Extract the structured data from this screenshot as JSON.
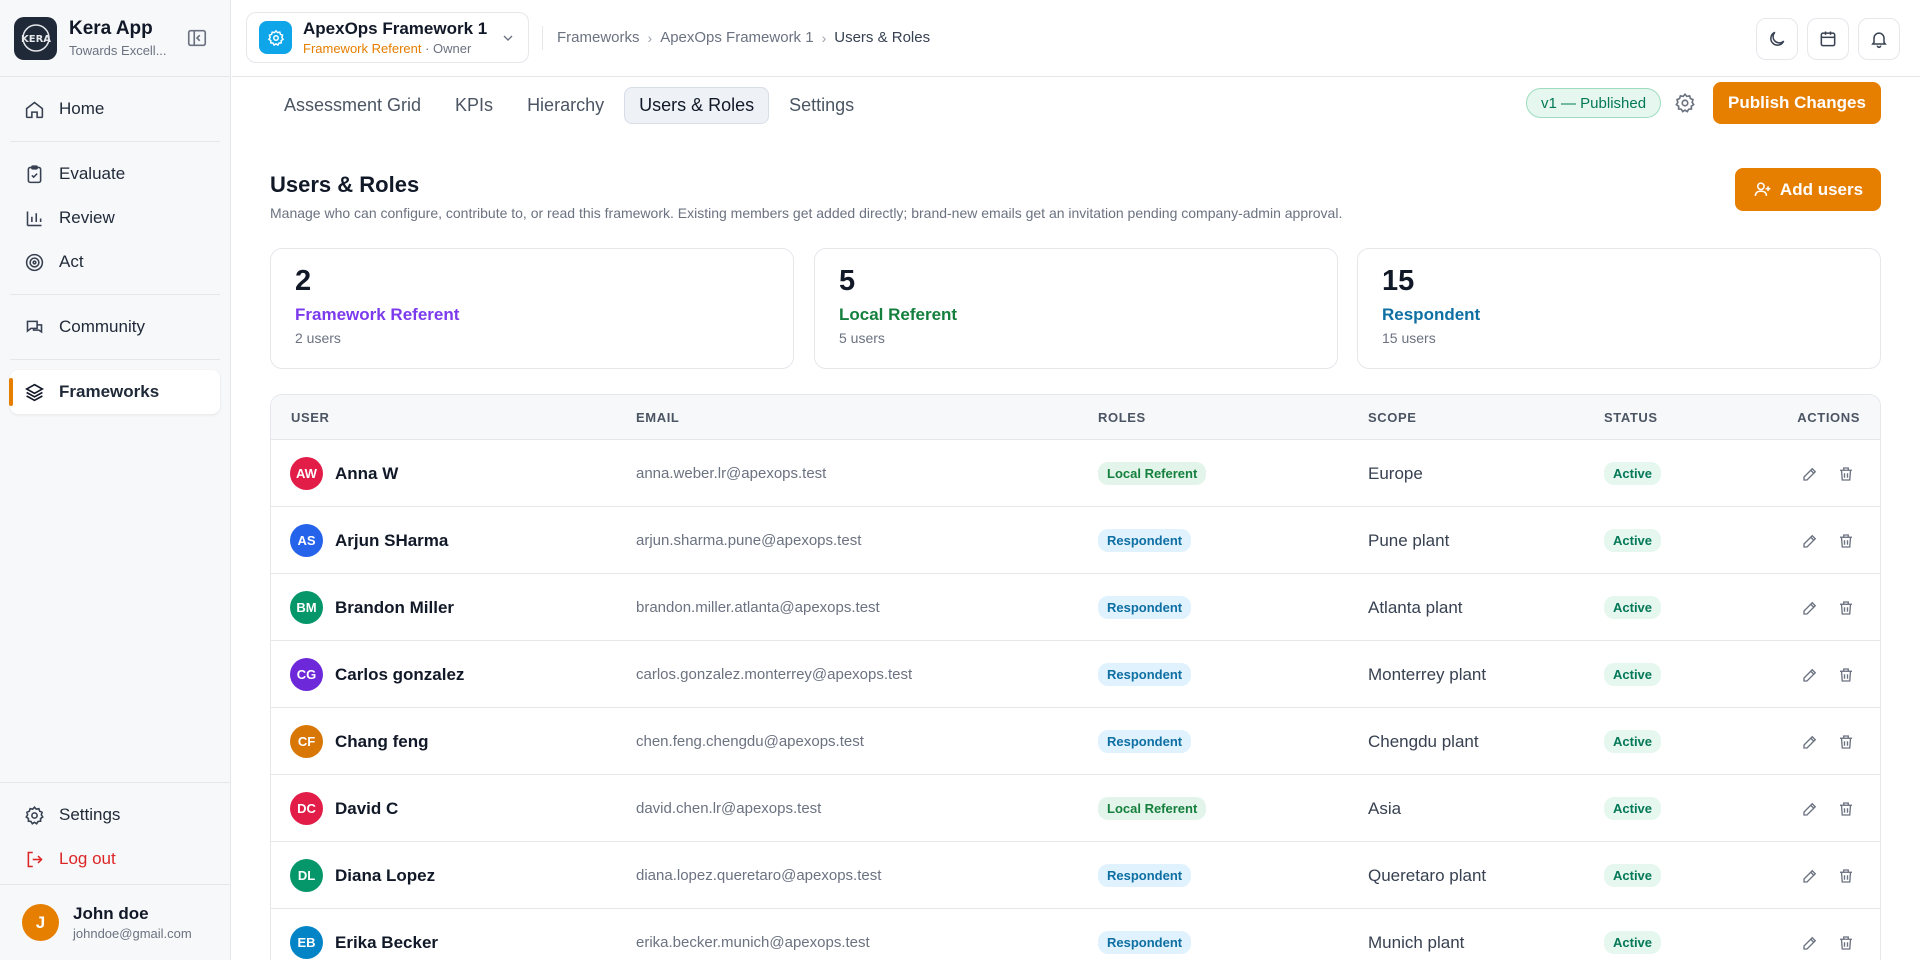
{
  "app": {
    "name": "Kera App",
    "tagline": "Towards Excell..."
  },
  "sidebar": {
    "items": [
      {
        "label": "Home",
        "icon": "home-icon"
      },
      {
        "label": "Evaluate",
        "icon": "clipboard-check-icon"
      },
      {
        "label": "Review",
        "icon": "bar-chart-icon"
      },
      {
        "label": "Act",
        "icon": "target-icon"
      },
      {
        "label": "Community",
        "icon": "chat-icon"
      },
      {
        "label": "Frameworks",
        "icon": "layers-icon"
      }
    ],
    "bottom": [
      {
        "label": "Settings",
        "icon": "gear-icon"
      },
      {
        "label": "Log out",
        "icon": "logout-icon"
      }
    ],
    "user": {
      "initial": "J",
      "name": "John doe",
      "email": "johndoe@gmail.com"
    }
  },
  "header": {
    "framework": {
      "name": "ApexOps Framework 1",
      "role": "Framework Referent",
      "separator": " · ",
      "owner": "Owner"
    },
    "breadcrumb": [
      "Frameworks",
      "ApexOps Framework 1",
      "Users & Roles"
    ]
  },
  "tabs": [
    "Assessment Grid",
    "KPIs",
    "Hierarchy",
    "Users & Roles",
    "Settings"
  ],
  "version_status": "v1 — Published",
  "publish_label": "Publish Changes",
  "page": {
    "title": "Users & Roles",
    "description": "Manage who can configure, contribute to, or read this framework. Existing members get added directly; brand-new emails get an invitation pending company-admin approval.",
    "add_label": "Add users"
  },
  "stats": [
    {
      "value": "2",
      "label": "Framework Referent",
      "sub": "2 users",
      "color": "#7c3aed"
    },
    {
      "value": "5",
      "label": "Local Referent",
      "sub": "5 users",
      "color": "#15803d"
    },
    {
      "value": "15",
      "label": "Respondent",
      "sub": "15 users",
      "color": "#0e6fa3"
    }
  ],
  "table": {
    "columns": [
      "USER",
      "EMAIL",
      "ROLES",
      "SCOPE",
      "STATUS",
      "ACTIONS"
    ],
    "rows": [
      {
        "initials": "AW",
        "color": "#e11d48",
        "name": "Anna W",
        "email": "anna.weber.lr@apexops.test",
        "role": "Local Referent",
        "role_type": "local",
        "scope": "Europe",
        "status": "Active"
      },
      {
        "initials": "AS",
        "color": "#2563eb",
        "name": "Arjun SHarma",
        "email": "arjun.sharma.pune@apexops.test",
        "role": "Respondent",
        "role_type": "resp",
        "scope": "Pune plant",
        "status": "Active"
      },
      {
        "initials": "BM",
        "color": "#059669",
        "name": "Brandon Miller",
        "email": "brandon.miller.atlanta@apexops.test",
        "role": "Respondent",
        "role_type": "resp",
        "scope": "Atlanta plant",
        "status": "Active"
      },
      {
        "initials": "CG",
        "color": "#6d28d9",
        "name": "Carlos gonzalez",
        "email": "carlos.gonzalez.monterrey@apexops.test",
        "role": "Respondent",
        "role_type": "resp",
        "scope": "Monterrey plant",
        "status": "Active"
      },
      {
        "initials": "CF",
        "color": "#d97706",
        "name": "Chang feng",
        "email": "chen.feng.chengdu@apexops.test",
        "role": "Respondent",
        "role_type": "resp",
        "scope": "Chengdu plant",
        "status": "Active"
      },
      {
        "initials": "DC",
        "color": "#e11d48",
        "name": "David C",
        "email": "david.chen.lr@apexops.test",
        "role": "Local Referent",
        "role_type": "local",
        "scope": "Asia",
        "status": "Active"
      },
      {
        "initials": "DL",
        "color": "#059669",
        "name": "Diana Lopez",
        "email": "diana.lopez.queretaro@apexops.test",
        "role": "Respondent",
        "role_type": "resp",
        "scope": "Queretaro plant",
        "status": "Active"
      },
      {
        "initials": "EB",
        "color": "#0284c7",
        "name": "Erika Becker",
        "email": "erika.becker.munich@apexops.test",
        "role": "Respondent",
        "role_type": "resp",
        "scope": "Munich plant",
        "status": "Active"
      }
    ]
  },
  "colors": {
    "accent": "#e67e00",
    "published": "#047857"
  }
}
